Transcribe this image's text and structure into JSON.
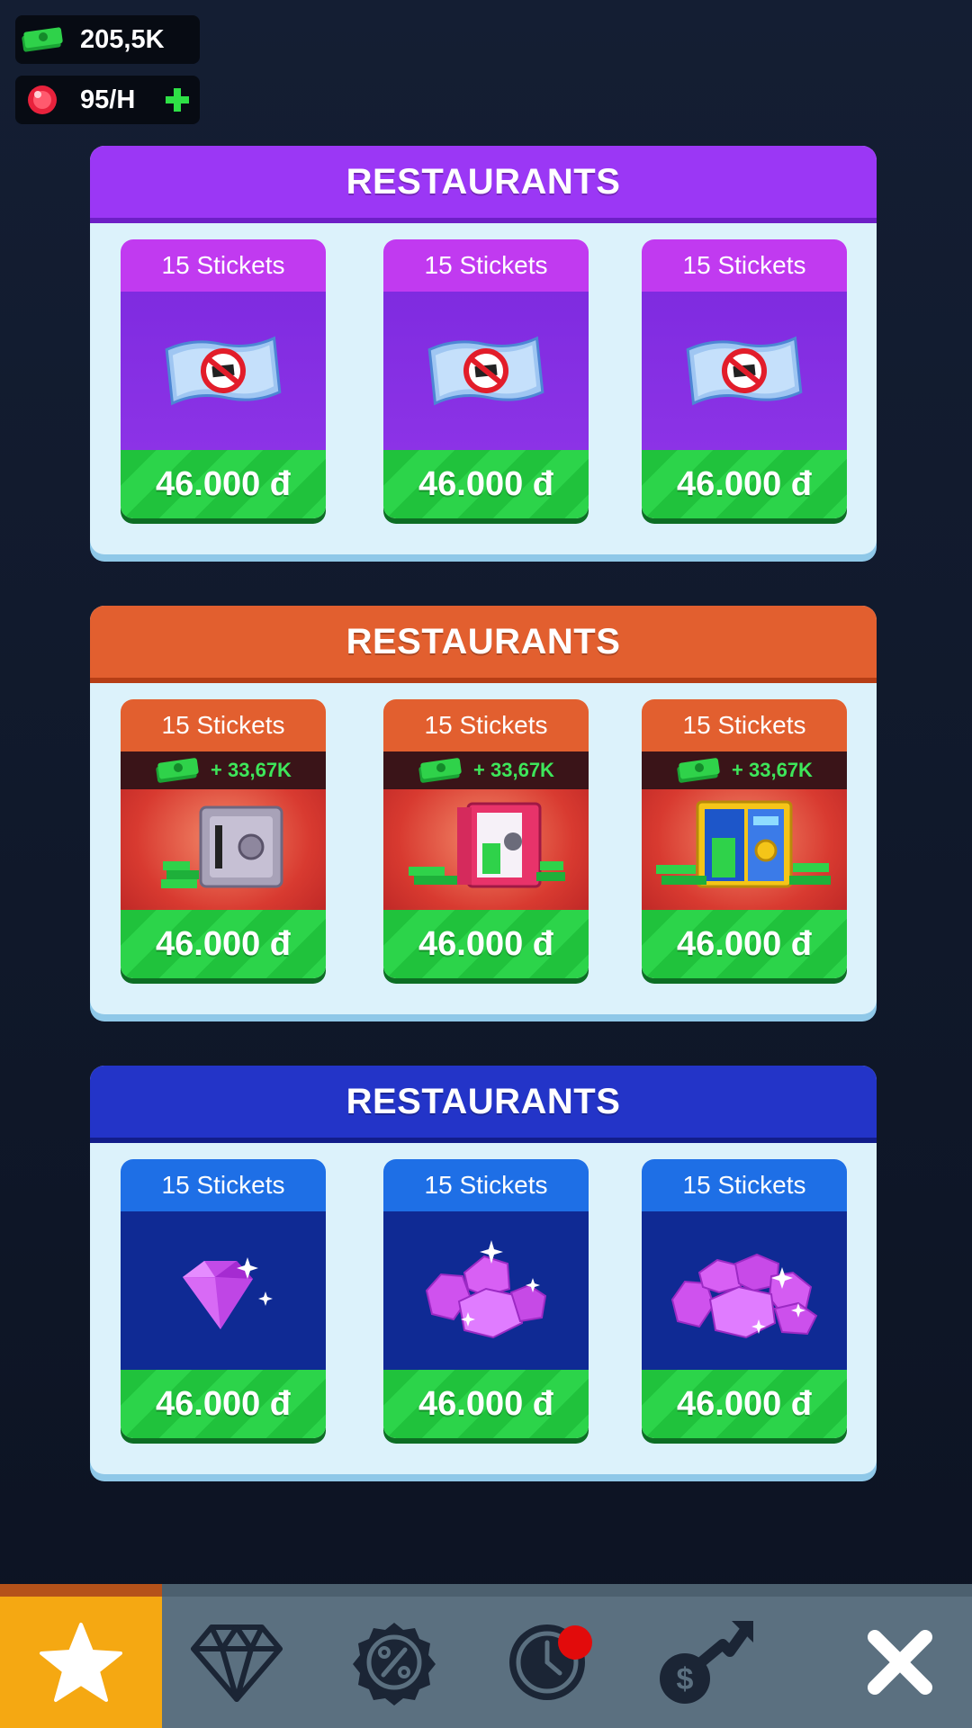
{
  "resources": {
    "cash": {
      "value": "205,5K",
      "icon": "cash-stack-icon"
    },
    "gems": {
      "value": "95/H",
      "icon": "ruby-gem-icon",
      "add_icon": "plus-icon"
    }
  },
  "sections": [
    {
      "title": "RESTAURANTS",
      "color": "#9b37f5",
      "cards": [
        {
          "label": "15 Stickets",
          "price": "46.000 đ",
          "icon": "no-ads-ticket-icon"
        },
        {
          "label": "15 Stickets",
          "price": "46.000 đ",
          "icon": "no-ads-ticket-icon"
        },
        {
          "label": "15 Stickets",
          "price": "46.000 đ",
          "icon": "no-ads-ticket-icon"
        }
      ]
    },
    {
      "title": "RESTAURANTS",
      "color": "#e25f2f",
      "cards": [
        {
          "label": "15 Stickets",
          "bonus": "+ 33,67K",
          "price": "46.000 đ",
          "icon": "small-safe-icon"
        },
        {
          "label": "15 Stickets",
          "bonus": "+ 33,67K",
          "price": "46.000 đ",
          "icon": "open-safe-icon"
        },
        {
          "label": "15 Stickets",
          "bonus": "+ 33,67K",
          "price": "46.000 đ",
          "icon": "vault-icon"
        }
      ]
    },
    {
      "title": "RESTAURANTS",
      "color": "#2334c8",
      "cards": [
        {
          "label": "15 Stickets",
          "price": "46.000 đ",
          "icon": "single-gem-icon"
        },
        {
          "label": "15 Stickets",
          "price": "46.000 đ",
          "icon": "gem-pile-icon"
        },
        {
          "label": "15 Stickets",
          "price": "46.000 đ",
          "icon": "gem-heap-icon"
        }
      ]
    }
  ],
  "nav": {
    "tabs": [
      {
        "icon": "star-icon",
        "active": true
      },
      {
        "icon": "diamond-icon",
        "active": false
      },
      {
        "icon": "discount-badge-icon",
        "active": false
      },
      {
        "icon": "clock-icon",
        "active": false,
        "notification": true
      },
      {
        "icon": "money-growth-icon",
        "active": false
      },
      {
        "icon": "close-icon",
        "active": false
      }
    ],
    "active_color": "#f5a812"
  }
}
